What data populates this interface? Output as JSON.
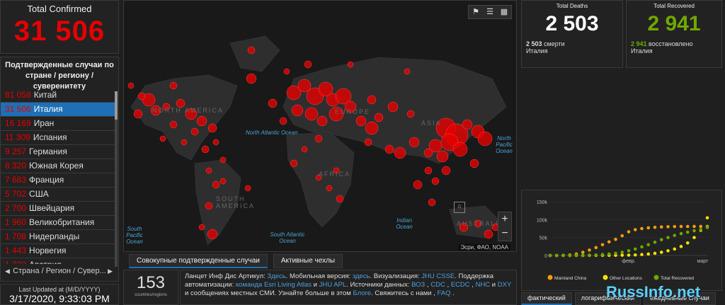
{
  "total_confirmed": {
    "label": "Total Confirmed",
    "value": "31 506"
  },
  "country_list": {
    "header": "Подтвержденные случаи по стране / региону / суверенитету",
    "items": [
      {
        "count": "81 058",
        "name": "Китай"
      },
      {
        "count": "31 506",
        "name": "Италия",
        "selected": true
      },
      {
        "count": "16 169",
        "name": "Иран"
      },
      {
        "count": "11 309",
        "name": "Испания"
      },
      {
        "count": "9 257",
        "name": "Германия"
      },
      {
        "count": "8 320",
        "name": "Южная Корея"
      },
      {
        "count": "7 683",
        "name": "Франция"
      },
      {
        "count": "5 702",
        "name": "США"
      },
      {
        "count": "2 700",
        "name": "Швейцария"
      },
      {
        "count": "1 960",
        "name": "Великобритания"
      },
      {
        "count": "1 708",
        "name": "Нидерланды"
      },
      {
        "count": "1 443",
        "name": "Норвегия"
      },
      {
        "count": "1 332",
        "name": "Австрия"
      }
    ],
    "footer": "Страна / Регион / Сувер..."
  },
  "last_updated": {
    "label": "Last Updated at (M/D/YYYY)",
    "value": "3/17/2020, 9:33:03 PM"
  },
  "map": {
    "ocean_labels": [
      "North Atlantic Ocean",
      "North Pacific Ocean",
      "South Atlantic Ocean",
      "Indian Ocean",
      "South Pacific Ocean"
    ],
    "continent_labels": [
      "NORTH AMERICA",
      "EUROPE",
      "ASIA",
      "AFRICA",
      "SOUTH AMERICA",
      "AUSTRALIA"
    ],
    "attribution": "Эсри, ФАО, NOAA",
    "tools": [
      "bookmark-icon",
      "list-icon",
      "grid-icon"
    ],
    "zoom_in": "+",
    "zoom_out": "−"
  },
  "map_tabs": [
    {
      "label": "Совокупные подтвержденные случаи",
      "active": true
    },
    {
      "label": "Активные чехлы",
      "active": false
    }
  ],
  "regions": {
    "value": "153",
    "label": "countries/regions"
  },
  "info": {
    "line1_prefix": "Ланцет Инф Дис Артикул:",
    "link_here1": "Здесь",
    "mobile_prefix": ". Мобильная версия:",
    "link_here2": "здесь",
    "vis_prefix": ". Визуализация:",
    "link_jhu": "JHU CSSE",
    "support": ". Поддержка автоматизации:",
    "link_esri": "команда Esri Living Atlas",
    "and": "и",
    "link_apl": "JHU APL",
    "sources": ". Источники данных:",
    "link_who": "ВОЗ",
    "link_cdc": "CDC",
    "link_ecdc": "ECDC",
    "link_nhc": "NHC",
    "link_dxy": "DXY",
    "local": "и сообщениях местных СМИ. Узнайте больше в этом",
    "link_blog": "Блоге",
    "contact": ". Свяжитесь с нами",
    "link_faq": "FAQ"
  },
  "deaths": {
    "label": "Total Deaths",
    "value": "2 503",
    "sub_value": "2 503",
    "sub_label": "смерти",
    "country": "Италия"
  },
  "recovered": {
    "label": "Total Recovered",
    "value": "2 941",
    "sub_value": "2 941",
    "sub_label": "восстановлено",
    "country": "Италия"
  },
  "chart_tabs": [
    {
      "label": "фактический",
      "active": true
    },
    {
      "label": "логарифмический",
      "active": false
    },
    {
      "label": "ежедневные случаи",
      "active": false
    }
  ],
  "watermark": "RussInfo.net",
  "colors": {
    "confirmed": "#e60000",
    "recovered": "#70a800",
    "accent": "#1e6fb5",
    "china": "#f39c12",
    "other": "#f5e100"
  },
  "chart_data": {
    "type": "line",
    "x_ticks": [
      "февр.",
      "март"
    ],
    "y_ticks": [
      "0",
      "50k",
      "100k",
      "150k"
    ],
    "ylim": [
      0,
      150000
    ],
    "series": [
      {
        "name": "Mainland China",
        "color": "#f39c12",
        "values": [
          0,
          0,
          500,
          1500,
          4000,
          9000,
          15000,
          22000,
          30000,
          38000,
          45000,
          55000,
          66000,
          72000,
          75000,
          77000,
          78500,
          79500,
          80200,
          80600,
          80800,
          80900,
          81000,
          81000,
          81050
        ]
      },
      {
        "name": "Other Locations",
        "color": "#f5e100",
        "values": [
          0,
          0,
          0,
          0,
          50,
          100,
          200,
          300,
          400,
          500,
          600,
          800,
          1000,
          1500,
          2500,
          4000,
          6000,
          9000,
          13000,
          18000,
          25000,
          35000,
          50000,
          70000,
          105000
        ]
      },
      {
        "name": "Total Recovered",
        "color": "#70a800",
        "values": [
          0,
          0,
          0,
          0,
          100,
          300,
          800,
          1500,
          2500,
          4000,
          6000,
          9000,
          13000,
          18000,
          24000,
          30000,
          37000,
          44000,
          50000,
          56000,
          61000,
          65000,
          69000,
          72000,
          78000
        ]
      }
    ]
  }
}
